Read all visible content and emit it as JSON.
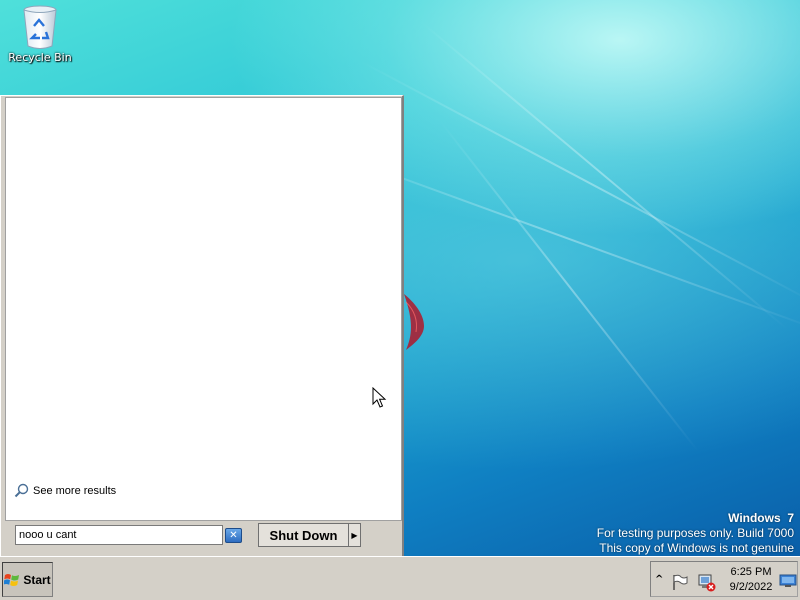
{
  "desktop": {
    "icons": [
      {
        "label": "Recycle Bin",
        "icon": "recycle-bin-icon"
      }
    ],
    "watermark": {
      "title": "Windows  7",
      "line1": "For testing purposes only. Build 7000",
      "line2": "This copy of Windows is not genuine"
    }
  },
  "start_menu": {
    "see_more_results": "See more results",
    "search": {
      "value": "nooo u cant",
      "placeholder": ""
    },
    "shutdown_label": "Shut Down",
    "shutdown_arrow": "▶"
  },
  "taskbar": {
    "start_label": "Start",
    "tray": {
      "expand": "^",
      "time": "6:25 PM",
      "date": "9/2/2022"
    }
  }
}
